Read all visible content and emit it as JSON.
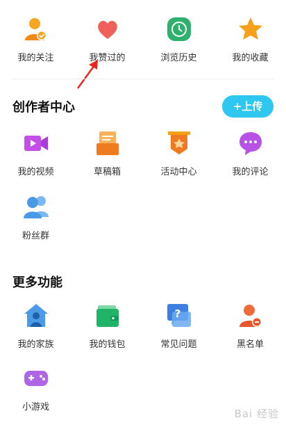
{
  "quick_links": [
    {
      "label": "我的关注",
      "icon": "person-check-icon"
    },
    {
      "label": "我赞过的",
      "icon": "heart-icon"
    },
    {
      "label": "浏览历史",
      "icon": "clock-icon"
    },
    {
      "label": "我的收藏",
      "icon": "star-icon"
    }
  ],
  "creator_center": {
    "title": "创作者中心",
    "upload_button": "上传",
    "items": [
      {
        "label": "我的视频",
        "icon": "video-camera-icon"
      },
      {
        "label": "草稿箱",
        "icon": "draft-box-icon"
      },
      {
        "label": "活动中心",
        "icon": "event-banner-icon"
      },
      {
        "label": "我的评论",
        "icon": "comment-bubble-icon"
      },
      {
        "label": "粉丝群",
        "icon": "fans-group-icon"
      }
    ]
  },
  "more_features": {
    "title": "更多功能",
    "items": [
      {
        "label": "我的家族",
        "icon": "family-house-icon"
      },
      {
        "label": "我的钱包",
        "icon": "wallet-icon"
      },
      {
        "label": "常见问题",
        "icon": "faq-icon"
      },
      {
        "label": "黑名单",
        "icon": "blacklist-user-icon"
      },
      {
        "label": "小游戏",
        "icon": "gamepad-icon"
      }
    ]
  },
  "watermark": "Bai 经验",
  "colors": {
    "accent": "#2ec7ef",
    "annotation_arrow": "#e8251f"
  }
}
